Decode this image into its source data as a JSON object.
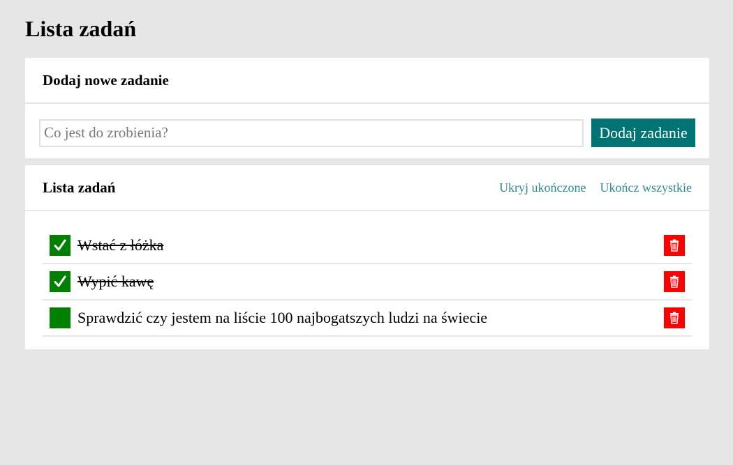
{
  "page": {
    "title": "Lista zadań"
  },
  "add_section": {
    "title": "Dodaj nowe zadanie",
    "input_placeholder": "Co jest do zrobienia?",
    "input_value": "",
    "button_label": "Dodaj zadanie"
  },
  "list_section": {
    "title": "Lista zadań",
    "hide_completed_label": "Ukryj ukończone",
    "complete_all_label": "Ukończ wszystkie"
  },
  "tasks": [
    {
      "label": "Wstać z łóżka",
      "done": true
    },
    {
      "label": "Wypić kawę",
      "done": true
    },
    {
      "label": "Sprawdzić czy jestem na liście 100 najbogatszych ludzi na świecie",
      "done": false
    }
  ],
  "icons": {
    "checkbox": "check-icon",
    "delete": "trash-icon"
  },
  "colors": {
    "background": "#e6e6e6",
    "accent": "#007373",
    "link": "#2a8c8c",
    "checkbox": "#008000",
    "delete": "#ff0000"
  }
}
